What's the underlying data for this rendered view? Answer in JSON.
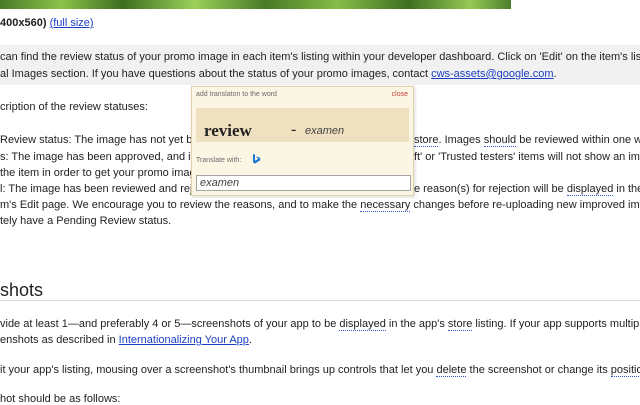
{
  "header": {
    "size_text": "400x560)",
    "full_size_link": "(full size)"
  },
  "intro": {
    "line1_a": " can find the review status of your promo image in each item's listing within your developer dashboard. Click on 'Edit' on the item's listing,",
    "line2_a": "al Images section. If you have questions about the status of your promo images, contact ",
    "email": "cws-assets@google.com",
    "line2_b": "."
  },
  "statuses": {
    "title": "cription of the review statuses:",
    "l1_a": "Review status: The image has not yet be",
    "l1_b": "store",
    "l1_c": ". Images ",
    "l1_d": "should",
    "l1_e": " be reviewed within one week",
    "l2_a": "s: The image has been approved, and is",
    "l2_b": "ft' or 'Trusted testers' items will not show an imag",
    "l3_a": "the item in order to get your promo image",
    "l4_a": "l: The image has been reviewed and reje",
    "l4_b": "e reason(s) for rejection will be ",
    "l4_c": "displayed",
    "l4_d": " in the F",
    "l5_a": "m's Edit page. We encourage you to review the reasons, and to make the ",
    "l5_b": "necessary",
    "l5_c": " changes before re-uploading new improved images",
    "l6_a": "tely have a Pending Review status."
  },
  "screenshots": {
    "heading": "shots",
    "p1_a": "vide at least 1—and preferably 4 or 5—screenshots of your app to be ",
    "p1_b": "displayed",
    "p1_c": " in the app's ",
    "p1_d": "store",
    "p1_e": " listing. If your app supports multiple loc",
    "p2_a": "enshots as described in ",
    "p2_link": "Internationalizing Your App",
    "p2_b": ".",
    "p3_a": "it your app's listing, mousing over a screenshot's thumbnail brings up controls that let you ",
    "p3_b": "delete",
    "p3_c": " the screenshot or change its ",
    "p3_d": "position",
    "p3_e": ".",
    "p4": "hot should be as follows:"
  },
  "popup": {
    "header": "add translaton to the word",
    "close": "close",
    "word": "review",
    "dash": "-",
    "translation": "examen",
    "translate_with": "Translate with:",
    "input_value": "examen",
    "bing_icon": "bing-icon",
    "bing_color": "#1f78d1"
  },
  "colors": {
    "link": "#1a3fc3",
    "popup_bg": "#fbf5e4",
    "popup_word_bg": "#efe0bf",
    "close": "#c1443a"
  }
}
